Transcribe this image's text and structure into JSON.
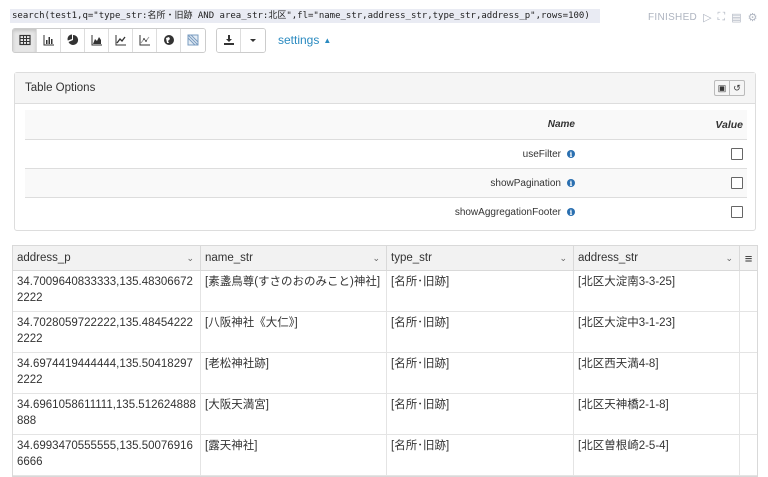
{
  "query": "search(test1,q=\"type_str:名所・旧跡 AND area_str:北区\",fl=\"name_str,address_str,type_str,address_p\",rows=100)",
  "status": {
    "label": "FINISHED"
  },
  "toolbar": {
    "views": [
      "table",
      "bar",
      "pie",
      "area",
      "line",
      "scatter",
      "map",
      "network"
    ],
    "active_view": "table",
    "settings_label": "settings"
  },
  "table_options": {
    "title": "Table Options",
    "col_name": "Name",
    "col_value": "Value",
    "options": [
      {
        "name": "useFilter",
        "checked": false
      },
      {
        "name": "showPagination",
        "checked": false
      },
      {
        "name": "showAggregationFooter",
        "checked": false
      }
    ]
  },
  "grid": {
    "columns": [
      "address_p",
      "name_str",
      "type_str",
      "address_str"
    ],
    "rows": [
      [
        "34.7009640833333,135.483066722222",
        "[素盞鳥尊(すさのおのみこと)神社]",
        "[名所･旧跡]",
        "[北区大淀南3-3-25]"
      ],
      [
        "34.7028059722222,135.484542222222",
        "[八阪神社《大仁》]",
        "[名所･旧跡]",
        "[北区大淀中3-1-23]"
      ],
      [
        "34.6974419444444,135.504182972222",
        "[老松神社跡]",
        "[名所･旧跡]",
        "[北区西天満4-8]"
      ],
      [
        "34.6961058611111,135.512624888888",
        "[大阪天満宮]",
        "[名所･旧跡]",
        "[北区天神橋2-1-8]"
      ],
      [
        "34.6993470555555,135.500769166666",
        "[露天神社]",
        "[名所･旧跡]",
        "[北区曽根崎2-5-4]"
      ]
    ]
  }
}
